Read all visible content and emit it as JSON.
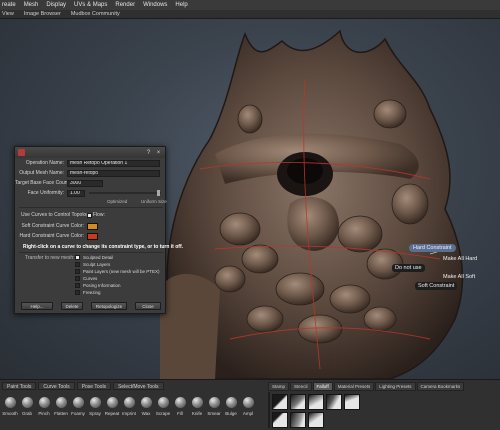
{
  "menubar": [
    "reate",
    "Mesh",
    "Display",
    "UVs & Maps",
    "Render",
    "Windows",
    "Help"
  ],
  "tabs": [
    "View",
    "Image Browser",
    "Mudbox Community"
  ],
  "viewport_labels": {
    "hard_constraint": "Hard Constraint",
    "make_all_hard": "Make All Hard",
    "do_not_use": "Do not use",
    "make_all_soft": "Make All Soft",
    "soft_constraint": "Soft Constraint"
  },
  "dialog": {
    "operation_name_label": "Operation Name:",
    "operation_name_value": "mesh Retopo Operation 1",
    "output_mesh_label": "Output Mesh Name:",
    "output_mesh_value": "mesh-retopo",
    "target_face_label": "Target Base Face Count:",
    "target_face_value": "3000",
    "face_uniformity_label": "Face Uniformity:",
    "face_uniformity_value": "1.00",
    "optimized_label": "Optimized",
    "uniform_size_label": "Uniform Size",
    "use_curves_label": "Use Curves to Control Topology Flow:",
    "soft_color_label": "Soft Constraint Curve Color:",
    "hard_color_label": "Hard Constraint Curve Color:",
    "soft_color": "#d08a1e",
    "hard_color": "#c83a18",
    "hint": "Right-click on a curve to change its constraint type, or to turn it off.",
    "transfer_label": "Transfer to new mesh:",
    "transfer_options": [
      {
        "label": "Sculpted Detail",
        "checked": true
      },
      {
        "label": "Sculpt Layers",
        "checked": false
      },
      {
        "label": "Paint Layers (new mesh will be PTEX)",
        "checked": false
      },
      {
        "label": "Curves",
        "checked": false
      },
      {
        "label": "Posing Information",
        "checked": false
      },
      {
        "label": "Freezing",
        "checked": false
      }
    ],
    "buttons": {
      "help": "Help...",
      "delete": "Delete",
      "retopologize": "Retopologize",
      "close": "Close"
    }
  },
  "shelf": {
    "tabs": [
      "Paint Tools",
      "Curve Tools",
      "Pose Tools",
      "Select/Move Tools"
    ],
    "tools": [
      {
        "name": "Smooth",
        "icon": "smooth-icon"
      },
      {
        "name": "Grab",
        "icon": "grab-icon"
      },
      {
        "name": "Pinch",
        "icon": "pinch-icon"
      },
      {
        "name": "Flatten",
        "icon": "flatten-icon"
      },
      {
        "name": "Foamy",
        "icon": "foamy-icon"
      },
      {
        "name": "Spray",
        "icon": "spray-icon"
      },
      {
        "name": "Repeat",
        "icon": "repeat-icon"
      },
      {
        "name": "Imprint",
        "icon": "imprint-icon"
      },
      {
        "name": "Wax",
        "icon": "wax-icon"
      },
      {
        "name": "Scrape",
        "icon": "scrape-icon"
      },
      {
        "name": "Fill",
        "icon": "fill-icon"
      },
      {
        "name": "Knife",
        "icon": "knife-icon"
      },
      {
        "name": "Smear",
        "icon": "smear-icon"
      },
      {
        "name": "Bulge",
        "icon": "bulge-icon"
      },
      {
        "name": "Ampl",
        "icon": "amplify-icon"
      }
    ],
    "right_tabs": [
      "Stamp",
      "Stencil",
      "Falloff",
      "Material Presets",
      "Lighting Presets",
      "Camera Bookmarks"
    ],
    "active_right_tab": "Falloff"
  }
}
